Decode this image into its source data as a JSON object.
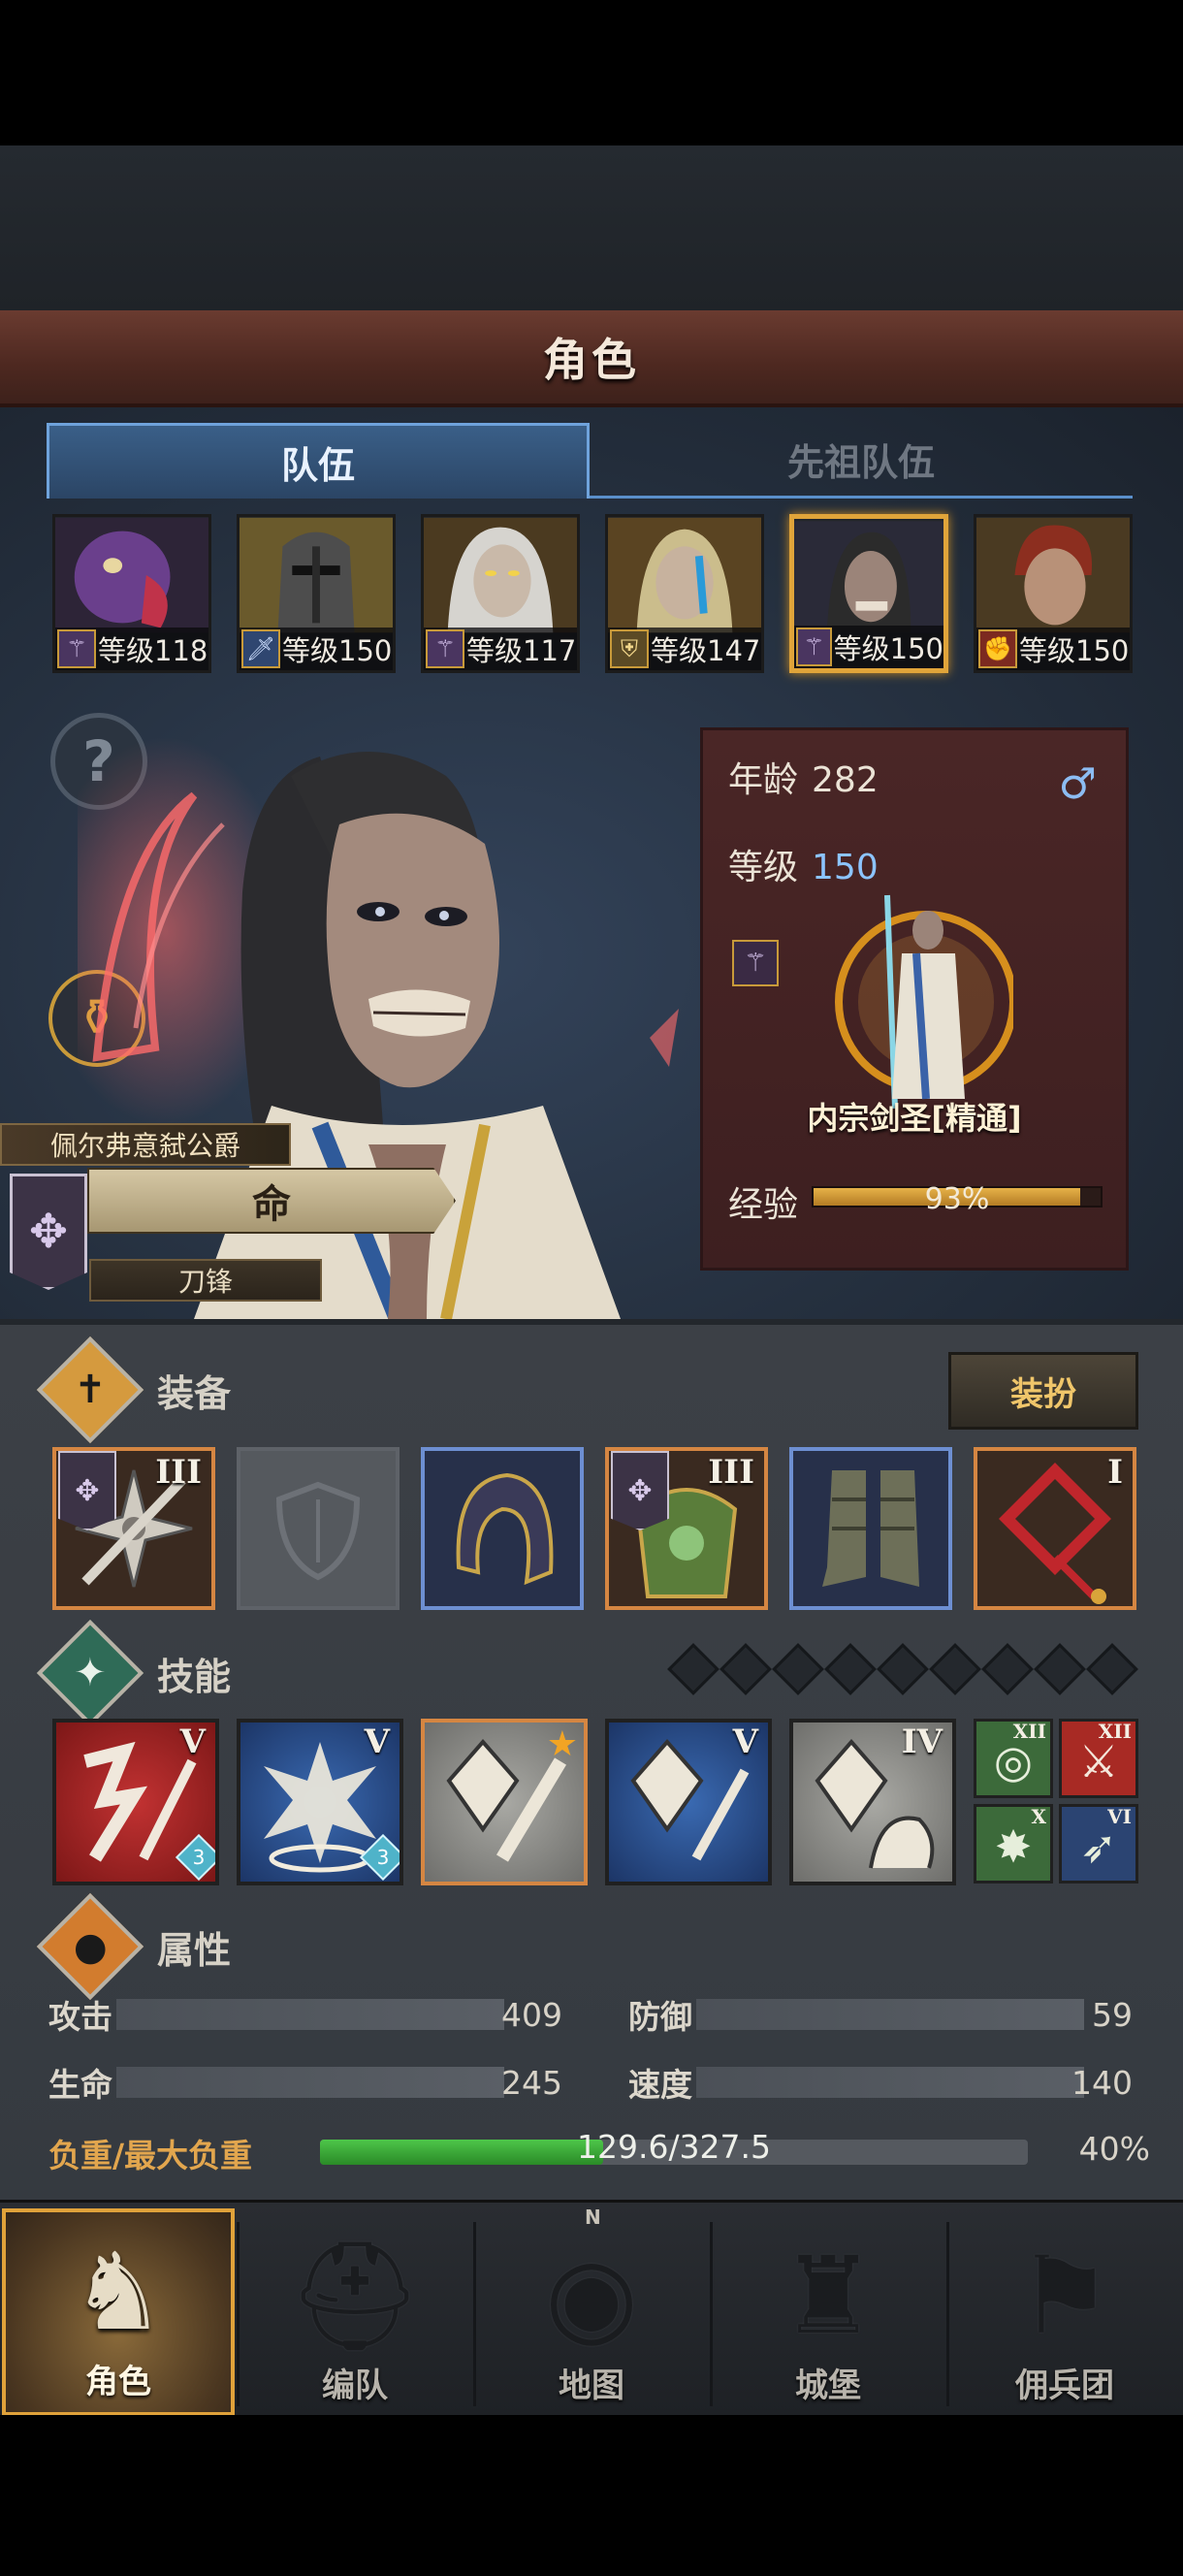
{
  "screen_title": "角色",
  "tabs": [
    {
      "label": "队伍",
      "active": true
    },
    {
      "label": "先祖队伍",
      "active": false
    }
  ],
  "party": [
    {
      "level_label": "等级118",
      "class_icon": "staff-icon",
      "portrait": "turkey-head-portrait",
      "selected": false
    },
    {
      "level_label": "等级150",
      "class_icon": "sword-icon",
      "portrait": "iron-helm-portrait",
      "selected": false
    },
    {
      "level_label": "等级117",
      "class_icon": "staff-icon",
      "portrait": "white-hair-elf-portrait",
      "selected": false
    },
    {
      "level_label": "等级147",
      "class_icon": "shield-icon",
      "portrait": "tattooed-elf-portrait",
      "selected": false
    },
    {
      "level_label": "等级150",
      "class_icon": "staff-icon",
      "portrait": "skull-jaw-elf-portrait",
      "selected": true
    },
    {
      "level_label": "等级150",
      "class_icon": "fist-icon",
      "portrait": "red-hair-man-portrait",
      "selected": false
    }
  ],
  "character": {
    "age_label": "年龄",
    "age": "282",
    "gender_symbol": "♂",
    "level_label": "等级",
    "level": "150",
    "class_name": "内宗剑圣[精通]",
    "exp_label": "经验",
    "exp_percent_text": "93%",
    "exp_fraction": 0.93,
    "title": "佩尔弗意弑公爵",
    "fate": "命",
    "trait": "刀锋"
  },
  "equipment": {
    "section_title": "装备",
    "dress_button": "装扮",
    "slots": [
      {
        "name": "shuriken-weapon",
        "rarity": "orange",
        "tier": "III",
        "has_flag": true
      },
      {
        "name": "empty-shield-slot",
        "rarity": "empty",
        "tier": "",
        "has_flag": false
      },
      {
        "name": "hood-helmet",
        "rarity": "blue",
        "tier": "",
        "has_flag": false
      },
      {
        "name": "jade-armor",
        "rarity": "orange",
        "tier": "III",
        "has_flag": true
      },
      {
        "name": "cloth-boots",
        "rarity": "blue",
        "tier": "",
        "has_flag": false
      },
      {
        "name": "red-knot-charm",
        "rarity": "orange",
        "tier": "I",
        "has_flag": false
      }
    ]
  },
  "skills": {
    "section_title": "技能",
    "slots_remaining": 9,
    "items": [
      {
        "name": "blade-slash-skill",
        "color": "red",
        "tier": "V",
        "gem": "3"
      },
      {
        "name": "burst-summon-skill",
        "color": "blue",
        "tier": "V",
        "gem": "3"
      },
      {
        "name": "crystal-dart-skill",
        "color": "orange-b",
        "tier": "★",
        "gem": ""
      },
      {
        "name": "crystal-sword-skill",
        "color": "blue",
        "tier": "V",
        "gem": ""
      },
      {
        "name": "crystal-arm-skill",
        "color": "gray",
        "tier": "IV",
        "gem": ""
      }
    ],
    "passives": [
      {
        "name": "target-passive",
        "tier": "XII",
        "symbol": "◎"
      },
      {
        "name": "blade-passive",
        "tier": "XII",
        "symbol": "⚔"
      },
      {
        "name": "burst-passive",
        "tier": "X",
        "symbol": "✸"
      },
      {
        "name": "bird-passive",
        "tier": "VI",
        "symbol": "➶"
      }
    ]
  },
  "attributes": {
    "section_title": "属性",
    "attack_label": "攻击",
    "attack": "409",
    "defense_label": "防御",
    "defense": "59",
    "hp_label": "生命",
    "hp": "245",
    "speed_label": "速度",
    "speed": "140",
    "load_label": "负重/最大负重",
    "load_text": "129.6/327.5",
    "load_percent_text": "40%",
    "load_fraction": 0.4
  },
  "nav": [
    {
      "label": "角色",
      "icon": "knight-icon",
      "active": true
    },
    {
      "label": "编队",
      "icon": "helmet-formation-icon",
      "active": false
    },
    {
      "label": "地图",
      "icon": "compass-map-icon",
      "active": false
    },
    {
      "label": "城堡",
      "icon": "castle-icon",
      "active": false
    },
    {
      "label": "佣兵团",
      "icon": "mercenary-banner-icon",
      "active": false
    }
  ],
  "compass_letter": "N",
  "colors": {
    "accent_gold": "#e0a43a",
    "tab_blue": "#5a8fca",
    "title_red": "#5a2f26",
    "load_green": "#3aa836"
  }
}
